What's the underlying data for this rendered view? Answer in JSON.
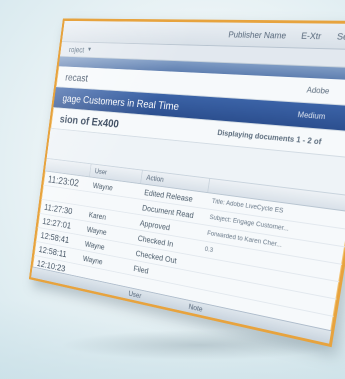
{
  "colors": {
    "frame": "#e7a33e",
    "selection": "#2c4f8f",
    "background": "#eef5f7"
  },
  "top": {
    "items": [
      "Publisher Name",
      "E-Xtr",
      "Serie"
    ]
  },
  "header": {
    "label": "roject"
  },
  "projects": [
    {
      "label": "recast",
      "right": "Adobe",
      "selected": false
    },
    {
      "label": "gage Customers in Real Time",
      "right": "Medium",
      "selected": true
    },
    {
      "label": "sion of Ex400",
      "right": "Displaying documents 1 - 2 of",
      "selected": false
    }
  ],
  "grid": {
    "headers": [
      "",
      "User",
      "Action",
      ""
    ],
    "rows": [
      {
        "time": "11:23:02",
        "user": "Wayne",
        "action": "Edited Release",
        "detail": "Title: Adobe LiveCycle ES"
      },
      {
        "time": "",
        "user": "",
        "action": "Document Read",
        "detail": "Subject: Engage Customer..."
      },
      {
        "time": "11:27:30",
        "user": "Karen",
        "action": "Approved",
        "detail": "Forwarded to Karen Cher..."
      },
      {
        "time": "12:27:01",
        "user": "Wayne",
        "action": "Checked In",
        "detail": "0.3"
      },
      {
        "time": "12:58:41",
        "user": "Wayne",
        "action": "Checked Out",
        "detail": ""
      },
      {
        "time": "12:58:11",
        "user": "Wayne",
        "action": "Filed",
        "detail": ""
      },
      {
        "time": "12:10:23",
        "user": "",
        "action": "",
        "detail": ""
      }
    ]
  },
  "footer": {
    "items": [
      "User",
      "Note"
    ]
  }
}
